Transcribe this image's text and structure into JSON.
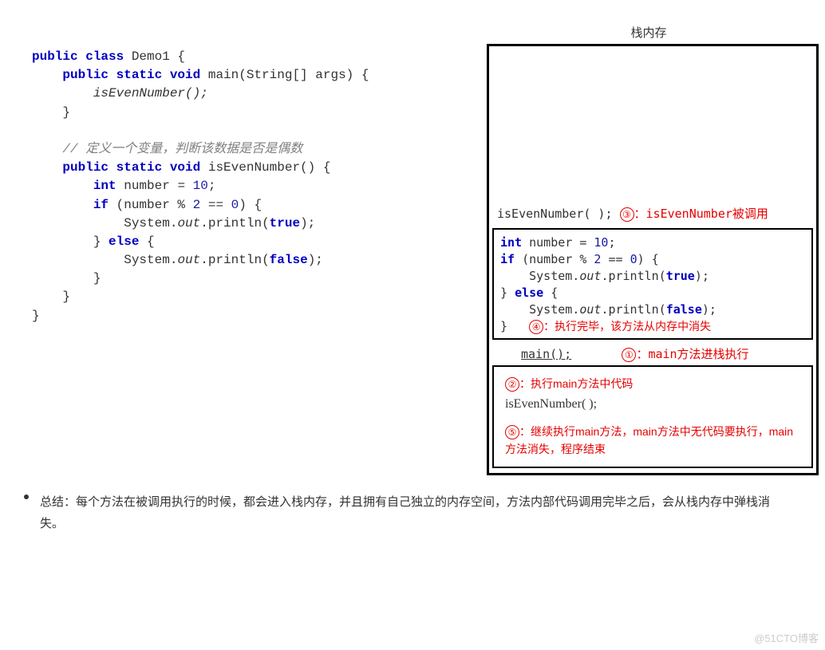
{
  "code": {
    "l1a": "public class",
    "l1b": " Demo1 {",
    "l2a": "    public static void",
    "l2b": " main(String[] args) {",
    "l3": "        isEvenNumber();",
    "l4": "    }",
    "l5": "",
    "l6": "    // 定义一个变量，判断该数据是否是偶数",
    "l7a": "    public static void",
    "l7b": " isEvenNumber() {",
    "l8a": "        int",
    "l8b": " number = ",
    "l8c": "10",
    "l8d": ";",
    "l9a": "        if",
    "l9b": " (number % ",
    "l9c": "2",
    "l9d": " == ",
    "l9e": "0",
    "l9f": ") {",
    "l10a": "            System.",
    "l10b": "out",
    "l10c": ".println(",
    "l10d": "true",
    "l10e": ");",
    "l11a": "        } ",
    "l11b": "else",
    "l11c": " {",
    "l12a": "            System.",
    "l12b": "out",
    "l12c": ".println(",
    "l12d": "false",
    "l12e": ");",
    "l13": "        }",
    "l14": "    }",
    "l15": "}"
  },
  "stack": {
    "title": "栈内存",
    "callLine": "isEvenNumber( );",
    "note3num": "③",
    "note3": "：isEvenNumber被调用",
    "frame_code": {
      "a1": "int",
      "a2": " number = ",
      "a3": "10",
      "a4": ";",
      "b1": "if",
      "b2": " (number % ",
      "b3": "2",
      "b4": " == ",
      "b5": "0",
      "b6": ") {",
      "c1": "    System.",
      "c2": "out",
      "c3": ".println(",
      "c4": "true",
      "c5": ");",
      "d1": "} ",
      "d2": "else",
      "d3": " {",
      "e1": "    System.",
      "e2": "out",
      "e3": ".println(",
      "e4": "false",
      "e5": ");",
      "f": "}"
    },
    "note4num": "④",
    "note4": "：执行完毕，该方法从内存中消失",
    "mainLabel": "main();",
    "note1num": "①",
    "note1": "：main方法进栈执行",
    "note2num": "②",
    "note2": "：执行main方法中代码",
    "mainCall": "isEvenNumber( );",
    "note5num": "⑤",
    "note5": "：继续执行main方法，main方法中无代码要执行，main方法消失，程序结束"
  },
  "summary": "总结：每个方法在被调用执行的时候，都会进入栈内存，并且拥有自己独立的内存空间，方法内部代码调用完毕之后，会从栈内存中弹栈消失。",
  "watermark": "@51CTO博客"
}
